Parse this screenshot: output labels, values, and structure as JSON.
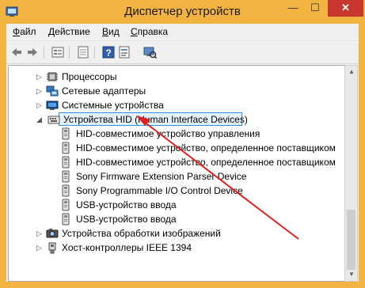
{
  "window": {
    "title": "Диспетчер устройств",
    "close_glyph": "✕",
    "min_glyph": "—",
    "max_glyph": "☐"
  },
  "menu": [
    {
      "label": "Файл",
      "key": "Ф",
      "rest": "айл"
    },
    {
      "label": "Действие",
      "key": "Д",
      "rest": "ействие"
    },
    {
      "label": "Вид",
      "key": "В",
      "rest": "ид"
    },
    {
      "label": "Справка",
      "key": "С",
      "rest": "правка"
    }
  ],
  "toolbar": {
    "icons": [
      "back-icon",
      "forward-icon",
      "properties-icon",
      "device-list-icon",
      "help-icon",
      "scan-hardware-icon"
    ]
  },
  "tree": {
    "items": [
      {
        "label": "Процессоры",
        "expander": "▷",
        "icon": "processor-icon"
      },
      {
        "label": "Сетевые адаптеры",
        "expander": "▷",
        "icon": "network-adapter-icon"
      },
      {
        "label": "Системные устройства",
        "expander": "▷",
        "icon": "system-device-icon"
      },
      {
        "label": "Устройства HID (Human Interface Devices)",
        "expander": "◢",
        "icon": "hid-icon",
        "selected": true
      },
      {
        "label": "Устройства обработки изображений",
        "expander": "▷",
        "icon": "imaging-device-icon"
      },
      {
        "label": "Хост-контроллеры IEEE 1394",
        "expander": "▷",
        "icon": "ieee1394-icon"
      }
    ],
    "children": [
      {
        "label": "HID-совместимое устройство управления"
      },
      {
        "label": "HID-совместимое устройство, определенное поставщиком"
      },
      {
        "label": "HID-совместимое устройство, определенное поставщиком"
      },
      {
        "label": "Sony Firmware Extension Parser Device"
      },
      {
        "label": "Sony Programmable I/O Control Device"
      },
      {
        "label": "USB-устройство ввода"
      },
      {
        "label": "USB-устройство ввода"
      }
    ]
  },
  "scrollbar": {
    "up": "▲",
    "down": "▼"
  },
  "colors": {
    "accent": "#f2b341",
    "selection": "#3a8fd8",
    "annotation_arrow": "#e02020"
  }
}
